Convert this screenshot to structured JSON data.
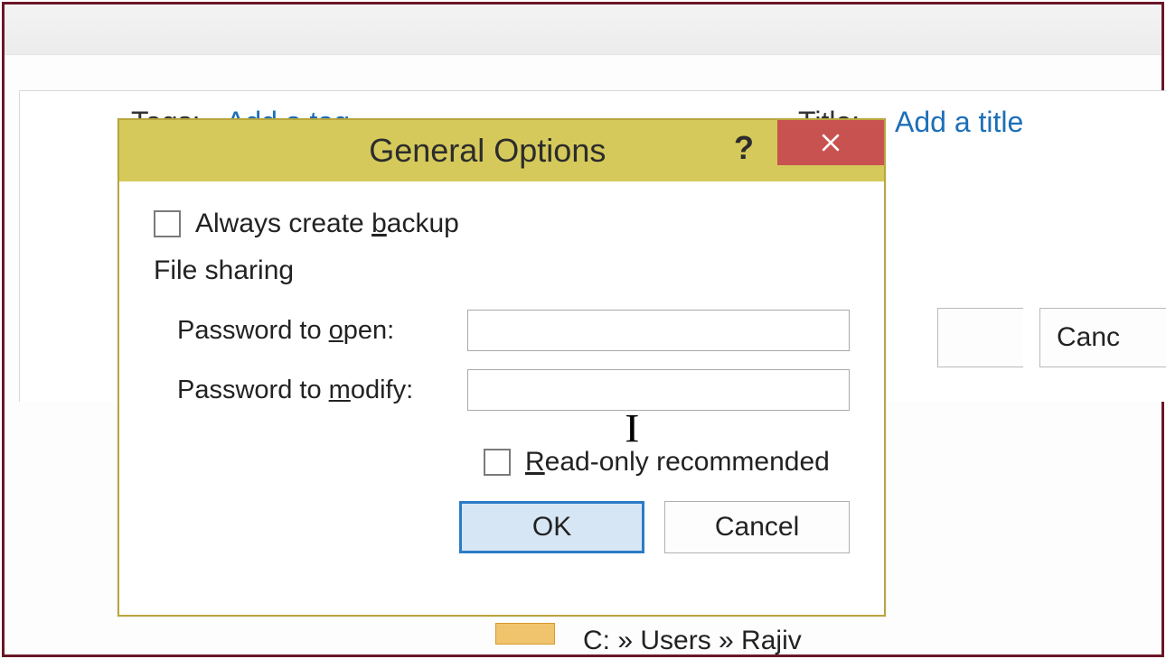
{
  "background": {
    "tags_label": "Tags:",
    "tags_value": "Add a tag",
    "title_label": "Title:",
    "title_value": "Add a title",
    "cancel_button": "Canc",
    "path_text": "C: » Users » Rajiv"
  },
  "dialog": {
    "title": "General Options",
    "help_symbol": "?",
    "always_backup_label_pre": "Always create ",
    "always_backup_label_u": "b",
    "always_backup_label_post": "ackup",
    "file_sharing_header": "File sharing",
    "password_open_label_pre": "Password to ",
    "password_open_label_u": "o",
    "password_open_label_post": "pen:",
    "password_modify_label_pre": "Password to ",
    "password_modify_label_u": "m",
    "password_modify_label_post": "odify:",
    "password_open_value": "",
    "password_modify_value": "",
    "readonly_label_u": "R",
    "readonly_label_post": "ead-only recommended",
    "ok_button": "OK",
    "cancel_button": "Cancel"
  }
}
